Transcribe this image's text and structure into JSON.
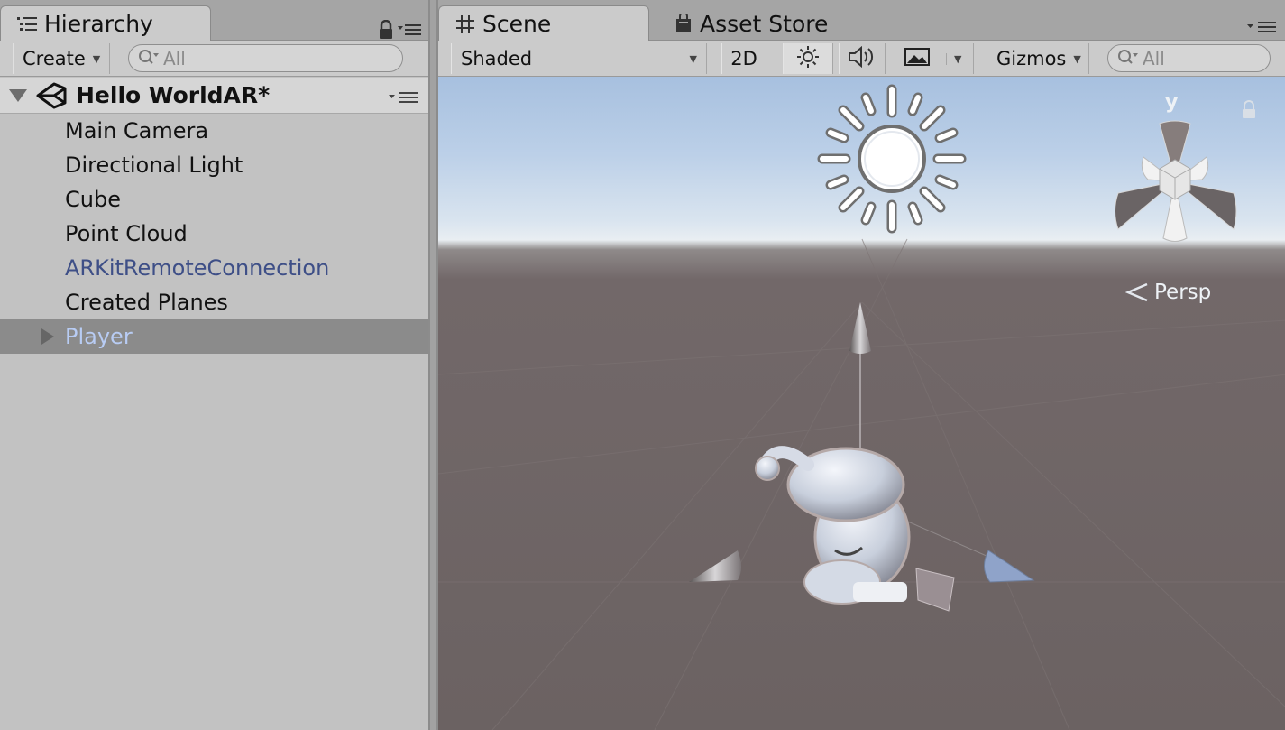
{
  "hierarchy": {
    "tab_label": "Hierarchy",
    "create_label": "Create",
    "search_placeholder": "All",
    "scene_name": "Hello WorldAR*",
    "items": [
      {
        "label": "Main Camera"
      },
      {
        "label": "Directional Light"
      },
      {
        "label": "Cube"
      },
      {
        "label": "Point Cloud"
      },
      {
        "label": "ARKitRemoteConnection"
      },
      {
        "label": "Created Planes"
      },
      {
        "label": "Player"
      }
    ]
  },
  "scene": {
    "tab_label": "Scene",
    "asset_store_label": "Asset Store",
    "shading_mode": "Shaded",
    "mode_2d_label": "2D",
    "gizmos_label": "Gizmos",
    "search_placeholder": "All",
    "gizmo_axis_label": "y",
    "projection_label": "Persp"
  },
  "colors": {
    "prefab_text": "#3e4f87",
    "selected_row": "#8b8b8b",
    "selected_text": "#b8ccf4",
    "ground": "#6b6262",
    "sky": "#bcd0e8"
  }
}
